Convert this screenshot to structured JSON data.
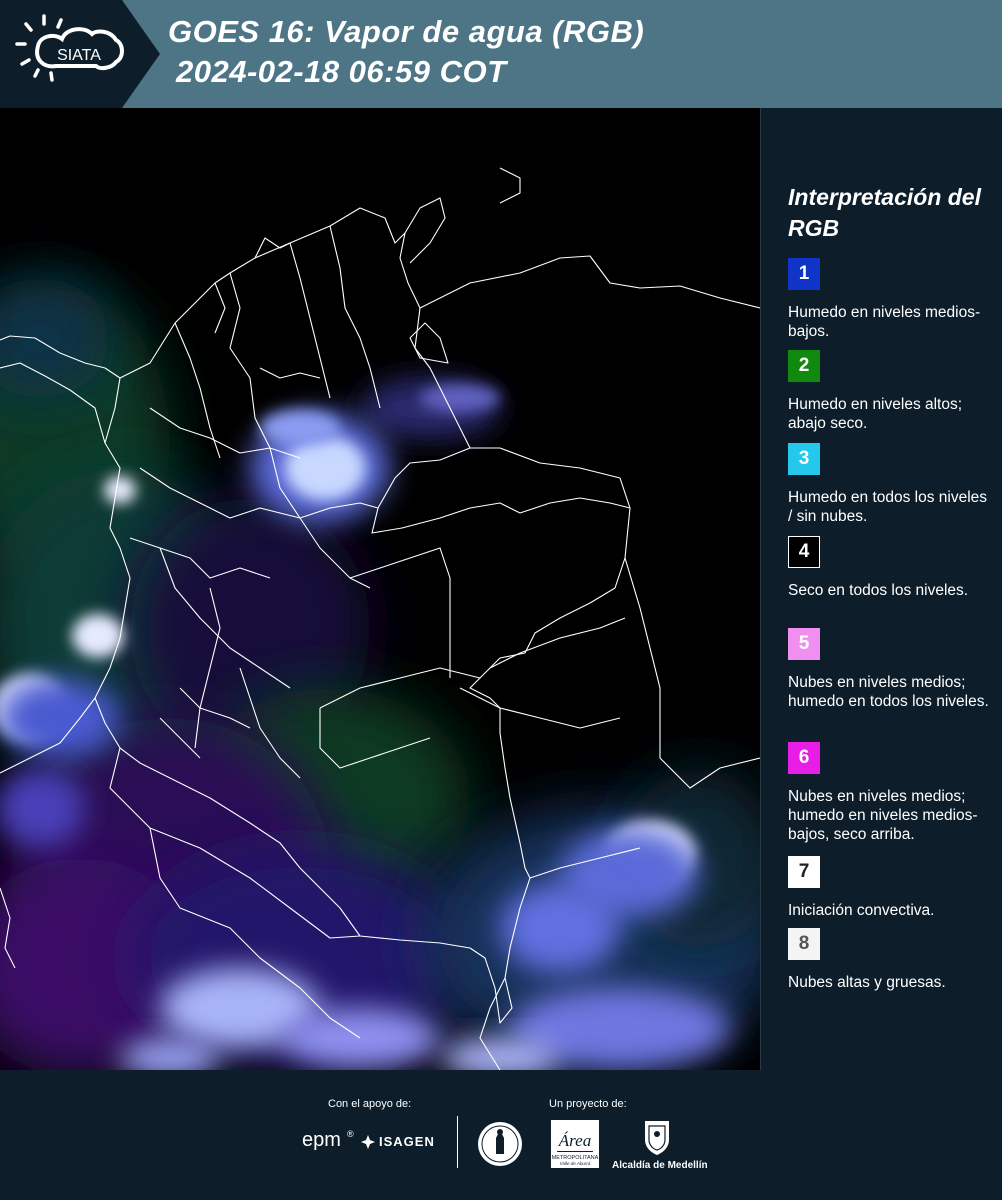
{
  "header": {
    "brand": "SIATA",
    "title_line1": "GOES 16: Vapor de agua (RGB)",
    "title_line2": "2024-02-18 06:59 COT",
    "background_color": "#4e7585",
    "logo_background_color": "#0d1e2a"
  },
  "map": {
    "background_color": "#000000",
    "boundary_color": "#ffffff"
  },
  "legend": {
    "title": "Interpretación del RGB",
    "items": [
      {
        "number": "1",
        "color": "#1033c8",
        "text_color": "#ffffff",
        "label": "Humedo en niveles medios-bajos."
      },
      {
        "number": "2",
        "color": "#0f8a0f",
        "text_color": "#ffffff",
        "label": "Humedo en niveles altos; abajo seco."
      },
      {
        "number": "3",
        "color": "#24c8ec",
        "text_color": "#ffffff",
        "label": "Humedo en todos los niveles / sin nubes."
      },
      {
        "number": "4",
        "color": "#000000",
        "text_color": "#ffffff",
        "label": "Seco en todos los niveles."
      },
      {
        "number": "5",
        "color": "#f08ff0",
        "text_color": "#ffffff",
        "label": "Nubes en niveles medios; humedo en todos los niveles."
      },
      {
        "number": "6",
        "color": "#e81ee8",
        "text_color": "#ffffff",
        "label": "Nubes en niveles medios; humedo en niveles medios-bajos, seco arriba."
      },
      {
        "number": "7",
        "color": "#ffffff",
        "text_color": "#222222",
        "label": "Iniciación convectiva."
      },
      {
        "number": "8",
        "color": "#f4f4f4",
        "text_color": "#555555",
        "label": "Nubes altas y gruesas."
      }
    ]
  },
  "footer": {
    "support_caption": "Con el apoyo de:",
    "project_caption": "Un proyecto de:",
    "epm_label": "epm",
    "isagen_label": "ISAGEN",
    "metropolitana_title": "Área",
    "metropolitana_label": "METROPOLITANA",
    "metropolitana_sub": "Valle de Aburrá",
    "alcaldia_label": "Alcaldía de Medellín"
  }
}
